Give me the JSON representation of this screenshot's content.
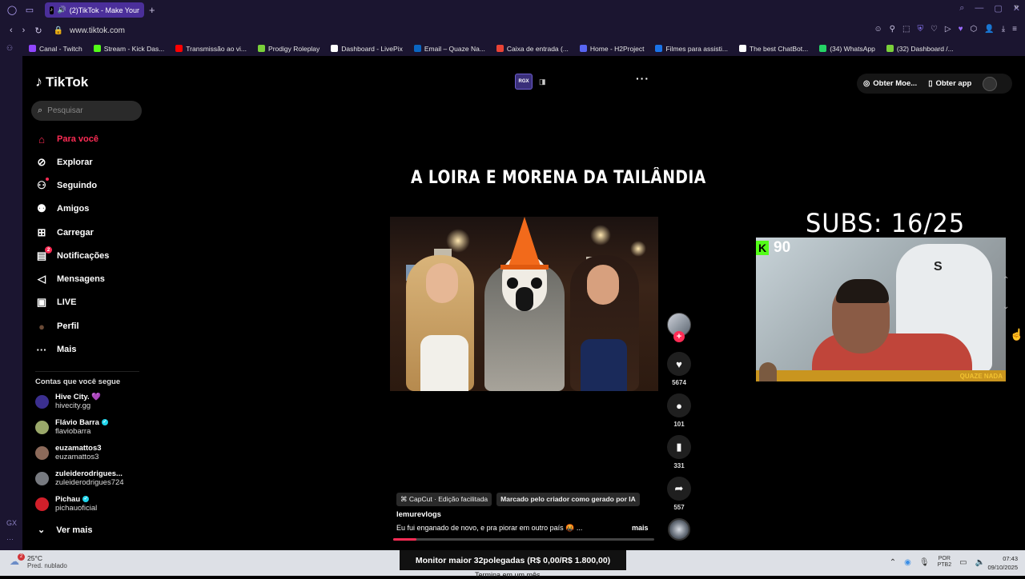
{
  "browser": {
    "tab_title": "(2)TikTok - Make Your",
    "url": "www.tiktok.com",
    "new_tab": "+",
    "bookmarks": [
      {
        "label": "Canal - Twitch",
        "color": "#9146ff"
      },
      {
        "label": "Stream - Kick Das...",
        "color": "#53fc18"
      },
      {
        "label": "Transmissão ao vi...",
        "color": "#ff0000"
      },
      {
        "label": "Prodigy Roleplay",
        "color": "#7ad03a"
      },
      {
        "label": "Dashboard - LivePix",
        "color": "#ffffff"
      },
      {
        "label": "Email – Quaze Na...",
        "color": "#0a66c2"
      },
      {
        "label": "Caixa de entrada (...",
        "color": "#ea4335"
      },
      {
        "label": "Home - H2Project",
        "color": "#5865f2"
      },
      {
        "label": "Filmes para assisti...",
        "color": "#1a73e8"
      },
      {
        "label": "The best ChatBot...",
        "color": "#ffffff"
      },
      {
        "label": "(34) WhatsApp",
        "color": "#25d366"
      },
      {
        "label": "(32) Dashboard /...",
        "color": "#7ad03a"
      }
    ]
  },
  "sidebar": {
    "logo": "TikTok",
    "search_placeholder": "Pesquisar",
    "nav": [
      {
        "label": "Para você",
        "icon": "home-icon",
        "active": true
      },
      {
        "label": "Explorar",
        "icon": "compass-icon"
      },
      {
        "label": "Seguindo",
        "icon": "following-icon"
      },
      {
        "label": "Amigos",
        "icon": "friends-icon"
      },
      {
        "label": "Carregar",
        "icon": "upload-icon"
      },
      {
        "label": "Notificações",
        "icon": "notifications-icon",
        "badge": "2"
      },
      {
        "label": "Mensagens",
        "icon": "messages-icon"
      },
      {
        "label": "LIVE",
        "icon": "live-icon"
      },
      {
        "label": "Perfil",
        "icon": "profile-icon"
      },
      {
        "label": "Mais",
        "icon": "more-icon"
      }
    ],
    "following_title": "Contas que você segue",
    "following": [
      {
        "name": "Hive City. 💜",
        "handle": "hivecity.gg",
        "color": "#3b2f8f",
        "verified": false
      },
      {
        "name": "Flávio Barra",
        "handle": "flaviobarra",
        "color": "#9aa86a",
        "verified": true
      },
      {
        "name": "euzamattos3",
        "handle": "euzamattos3",
        "color": "#8c6a5a",
        "verified": false
      },
      {
        "name": "zuleiderodrigues...",
        "handle": "zuleiderodrigues724",
        "color": "#777a80",
        "verified": false
      },
      {
        "name": "Pichau",
        "handle": "pichauoficial",
        "color": "#d11f2a",
        "verified": true
      }
    ],
    "see_more": "Ver mais"
  },
  "topbar": {
    "rgx_label": "RGX",
    "coins_label": "Obter Moe...",
    "app_label": "Obter app"
  },
  "video": {
    "title": "A LOIRA E MORENA DA TAILÂNDIA",
    "likes": "5674",
    "comments": "101",
    "saves": "331",
    "shares": "557",
    "tag_capcut": "CapCut · Edição facilitada",
    "tag_ai": "Marcado pelo criador como gerado por IA",
    "author": "lemurevlogs",
    "description": "Eu fui enganado de novo, e pra piorar em outro país 🤬 ...",
    "more": "mais",
    "progress_pct": 0.09
  },
  "overlay": {
    "subs": "SUBS: 16/25",
    "kick_count": "90",
    "webcam_logo": "QUAZE NADA"
  },
  "taskbar": {
    "temp": "25°C",
    "weather_desc": "Pred. nublado",
    "weather_badge": "2",
    "ticker": "Monitor maior 32polegadas (R$ 0,00/R$ 1.800,00)",
    "ticker2": "Termina em um mês",
    "lang1": "POR",
    "lang2": "PTB2",
    "time": "07:43",
    "date": "09/10/2025"
  }
}
